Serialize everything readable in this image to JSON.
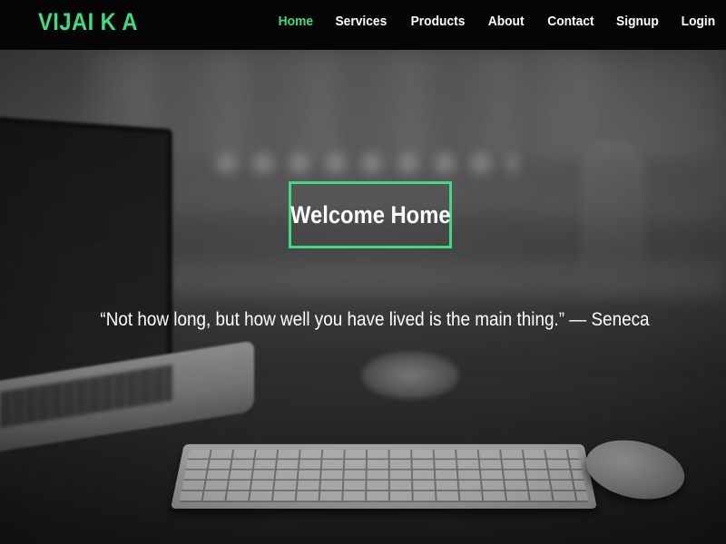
{
  "brand": {
    "name": "VIJAI K A",
    "color": "#3ddc84"
  },
  "nav": {
    "items": [
      {
        "label": "Home",
        "active": true
      },
      {
        "label": "Services",
        "active": false
      },
      {
        "label": "Products",
        "active": false
      },
      {
        "label": "About",
        "active": false
      },
      {
        "label": "Contact",
        "active": false
      },
      {
        "label": "Signup",
        "active": false
      },
      {
        "label": "Login",
        "active": false
      }
    ],
    "active_color": "#3ddc84",
    "text_color": "#ffffff",
    "background": "#050505"
  },
  "hero": {
    "heading": "Welcome Home",
    "quote": "“Not how long, but how well you have lived is the main thing.” — Seneca",
    "border_color": "#3ddc84"
  }
}
